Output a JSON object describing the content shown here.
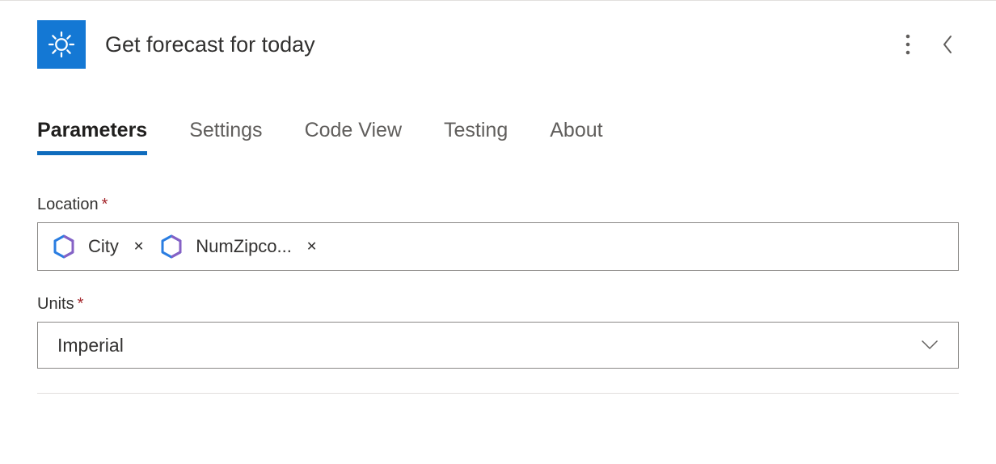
{
  "header": {
    "title": "Get forecast for today",
    "icon": "sun-icon",
    "accent": "#1478d4"
  },
  "tabs": [
    {
      "label": "Parameters",
      "active": true
    },
    {
      "label": "Settings",
      "active": false
    },
    {
      "label": "Code View",
      "active": false
    },
    {
      "label": "Testing",
      "active": false
    },
    {
      "label": "About",
      "active": false
    }
  ],
  "fields": {
    "location": {
      "label": "Location",
      "required": true,
      "tokens": [
        {
          "label": "City"
        },
        {
          "label": "NumZipco..."
        }
      ]
    },
    "units": {
      "label": "Units",
      "required": true,
      "value": "Imperial"
    }
  }
}
